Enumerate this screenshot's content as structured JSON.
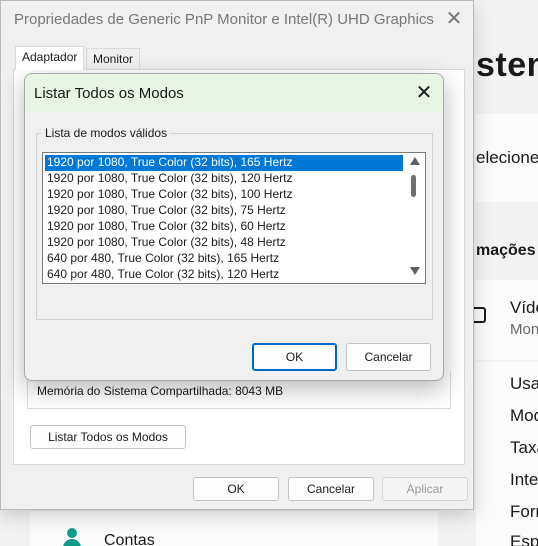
{
  "settings_bg": {
    "heading_fragment": "stem",
    "subtitle_fragment": "elecione u",
    "section_fragment": "mações",
    "video_item": "Víde",
    "video_sub": "Mon",
    "rows": [
      "Usa",
      "Mod",
      "Taxa",
      "Inte",
      "Forr",
      "Esp"
    ],
    "accounts_label": "Contas"
  },
  "properties_window": {
    "title": "Propriedades de Generic PnP Monitor e Intel(R) UHD Graphics",
    "close_glyph": "✕",
    "tabs": [
      {
        "label": "Adaptador",
        "active": true
      },
      {
        "label": "Monitor",
        "active": false
      }
    ],
    "shared_memory": "Memória do Sistema Compartilhada: 8043 MB",
    "list_all_modes_button": "Listar Todos os Modos",
    "ok_button": "OK",
    "cancel_button": "Cancelar",
    "apply_button": "Aplicar",
    "apply_disabled": true
  },
  "modal": {
    "title": "Listar Todos os Modos",
    "close_glyph": "✕",
    "group_label": "Lista de modos válidos",
    "modes": [
      "1920 por 1080, True Color (32 bits), 165 Hertz",
      "1920 por 1080, True Color (32 bits), 120 Hertz",
      "1920 por 1080, True Color (32 bits), 100 Hertz",
      "1920 por 1080, True Color (32 bits), 75 Hertz",
      "1920 por 1080, True Color (32 bits), 60 Hertz",
      "1920 por 1080, True Color (32 bits), 48 Hertz",
      "640 por 480, True Color (32 bits), 165 Hertz",
      "640 por 480, True Color (32 bits), 120 Hertz"
    ],
    "selected_index": 0,
    "ok_button": "OK",
    "cancel_button": "Cancelar"
  },
  "colors": {
    "selection": "#0078d7",
    "modal_titlebar": "#e9f5e4",
    "accounts_icon": "#0f9d8a"
  }
}
